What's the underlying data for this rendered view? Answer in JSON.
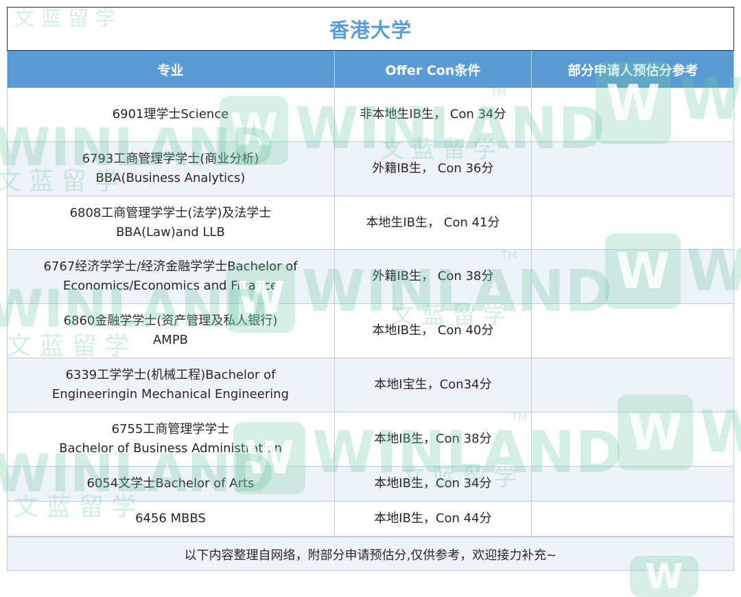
{
  "title": "香港大学",
  "headers": [
    "专业",
    "Offer Con条件",
    "部分申请人预估分参考"
  ],
  "rows": [
    {
      "major": [
        "6901理学士Science"
      ],
      "condition": "非本地生IB生， Con 34分",
      "estimate": ""
    },
    {
      "major": [
        "6793工商管理学学士(商业分析)",
        "BBA(Business Analytics)"
      ],
      "condition": "外籍IB生， Con 36分",
      "estimate": ""
    },
    {
      "major": [
        "6808工商管理学学士(法学)及法学士",
        "BBA(Law)and LLB"
      ],
      "condition": "本地生IB生， Con 41分",
      "estimate": ""
    },
    {
      "major": [
        "6767经济学学士/经济金融学学士Bachelor of",
        "Economics/Economics and Finance"
      ],
      "condition": "外籍IB生， Con 38分",
      "estimate": ""
    },
    {
      "major": [
        "6860金融学学士(资产管理及私人银行)",
        "AMPB"
      ],
      "condition": "本地IB生， Con 40分",
      "estimate": ""
    },
    {
      "major": [
        "6339工学学士(机械工程)Bachelor of",
        "Engineeringin Mechanical Engineering"
      ],
      "condition": "本地I宝生，Con34分",
      "estimate": ""
    },
    {
      "major": [
        "6755工商管理学学士",
        "Bachelor of Business Administration"
      ],
      "condition": "本地IB生，Con 38分",
      "estimate": ""
    },
    {
      "major": [
        "6054文学士Bachelor of Arts"
      ],
      "condition": "本地IB生，Con 34分",
      "estimate": ""
    },
    {
      "major": [
        "6456 MBBS"
      ],
      "condition": "本地IB生，Con 44分",
      "estimate": ""
    }
  ],
  "footer": "以下内容整理自网络，附部分申请预估分,仅供参考，欢迎接力补充~",
  "watermark": {
    "brand": "WINLAND",
    "cn": "文 蓝 留 学",
    "tm": "TM",
    "logo": "W"
  },
  "colors": {
    "accent": "#5b9bd5",
    "alt_row": "#eef3fa",
    "watermark": "#6ec8a0"
  }
}
